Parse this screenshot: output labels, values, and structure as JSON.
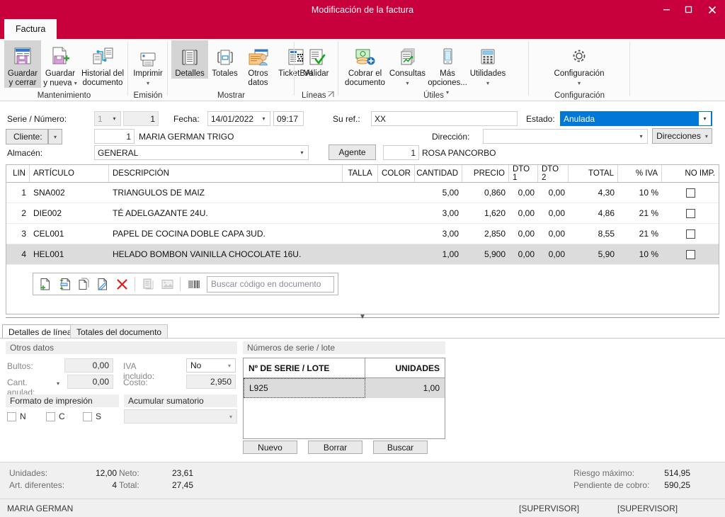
{
  "window": {
    "title": "Modificación de la factura",
    "minimize": "–",
    "maximize": "☐",
    "close": "✕",
    "accent": "#c8003c"
  },
  "tabs": {
    "factura": "Factura"
  },
  "ribbon": {
    "groups": [
      {
        "label": "Mantenimiento"
      },
      {
        "label": "Emisión"
      },
      {
        "label": "Mostrar"
      },
      {
        "label": "Líneas"
      },
      {
        "label": "Útiles"
      },
      {
        "label": "Configuración"
      }
    ],
    "buttons": {
      "guardar_cerrar": "Guardar\ny cerrar",
      "guardar_nueva": "Guardar\ny nueva",
      "historial": "Historial del\ndocumento",
      "imprimir": "Imprimir",
      "detalles": "Detalles",
      "totales": "Totales",
      "otros_datos": "Otros\ndatos",
      "ticketbai": "TicketBAI",
      "validar": "Validar",
      "cobrar": "Cobrar el\ndocumento",
      "consultas": "Consultas",
      "mas_opciones": "Más\nopciones...",
      "utilidades": "Utilidades",
      "configuracion": "Configuración"
    }
  },
  "form": {
    "serie_numero_label": "Serie / Número:",
    "serie_value": "1",
    "numero_value": "1",
    "fecha_label": "Fecha:",
    "fecha_value": "14/01/2022",
    "hora_value": "09:17",
    "su_ref_label": "Su ref.:",
    "su_ref_value": "XX",
    "estado_label": "Estado:",
    "estado_value": "Anulada",
    "cliente_label": "Cliente:",
    "cliente_code": "1",
    "cliente_name": "MARIA GERMAN TRIGO",
    "direccion_label": "Dirección:",
    "direccion_value": "",
    "direcciones_button": "Direcciones",
    "almacen_label": "Almacén:",
    "almacen_value": "GENERAL",
    "agente_button": "Agente",
    "agente_code": "1",
    "agente_name": "ROSA PANCORBO"
  },
  "grid": {
    "columns": [
      "LIN",
      "ARTÍCULO",
      "DESCRIPCIÓN",
      "TALLA",
      "COLOR",
      "CANTIDAD",
      "PRECIO",
      "DTO 1",
      "DTO 2",
      "TOTAL",
      "% IVA",
      "NO IMP."
    ],
    "rows": [
      {
        "lin": "1",
        "articulo": "SNA002",
        "descripcion": "TRIANGULOS DE MAIZ",
        "talla": "",
        "color": "",
        "cantidad": "5,00",
        "precio": "0,860",
        "dto1": "0,00",
        "dto2": "0,00",
        "total": "4,30",
        "iva": "10 %",
        "noimp": false,
        "selected": false
      },
      {
        "lin": "2",
        "articulo": "DIE002",
        "descripcion": "TÉ ADELGAZANTE 24U.",
        "talla": "",
        "color": "",
        "cantidad": "3,00",
        "precio": "1,620",
        "dto1": "0,00",
        "dto2": "0,00",
        "total": "4,86",
        "iva": "21 %",
        "noimp": false,
        "selected": false
      },
      {
        "lin": "3",
        "articulo": "CEL001",
        "descripcion": "PAPEL DE COCINA DOBLE CAPA 3UD.",
        "talla": "",
        "color": "",
        "cantidad": "3,00",
        "precio": "2,850",
        "dto1": "0,00",
        "dto2": "0,00",
        "total": "8,55",
        "iva": "21 %",
        "noimp": false,
        "selected": false
      },
      {
        "lin": "4",
        "articulo": "HEL001",
        "descripcion": "HELADO BOMBON VAINILLA CHOCOLATE 16U.",
        "talla": "",
        "color": "",
        "cantidad": "1,00",
        "precio": "5,900",
        "dto1": "0,00",
        "dto2": "0,00",
        "total": "5,90",
        "iva": "10 %",
        "noimp": false,
        "selected": true
      }
    ],
    "search_placeholder": "Buscar código en documento"
  },
  "bottom_tabs": {
    "detalles_linea": "Detalles de línea",
    "totales_documento": "Totales del documento"
  },
  "detalles_linea": {
    "otros_datos_header": "Otros datos",
    "bultos_label": "Bultos:",
    "bultos_value": "0,00",
    "cant_anulada_label": "Cant. anulad:",
    "cant_anulada_value": "0,00",
    "iva_incluido_label": "IVA incluido:",
    "iva_incluido_value": "No",
    "costo_label": "Costo:",
    "costo_value": "2,950",
    "formato_impresion_header": "Formato de impresión",
    "acumular_sumatorio_header": "Acumular sumatorio",
    "acumular_sumatorio_value": "",
    "chk_n": "N",
    "chk_c": "C",
    "chk_s": "S"
  },
  "series": {
    "header": "Números de serie / lote",
    "columns": [
      "Nº DE SERIE / LOTE",
      "UNIDADES"
    ],
    "rows": [
      {
        "serie": "L925",
        "unidades": "1,00"
      }
    ],
    "buttons": {
      "nuevo": "Nuevo",
      "borrar": "Borrar",
      "buscar": "Buscar"
    }
  },
  "status": {
    "unidades_label": "Unidades:",
    "unidades_value": "12,00",
    "neto_label": "Neto:",
    "neto_value": "23,61",
    "art_diferentes_label": "Art. diferentes:",
    "art_diferentes_value": "4",
    "total_label": "Total:",
    "total_value": "27,45",
    "riesgo_label": "Riesgo máximo:",
    "riesgo_value": "514,95",
    "pendiente_label": "Pendiente de cobro:",
    "pendiente_value": "590,25"
  },
  "userbar": {
    "user": "MARIA GERMAN",
    "role1": "[SUPERVISOR]",
    "role2": "[SUPERVISOR]"
  }
}
